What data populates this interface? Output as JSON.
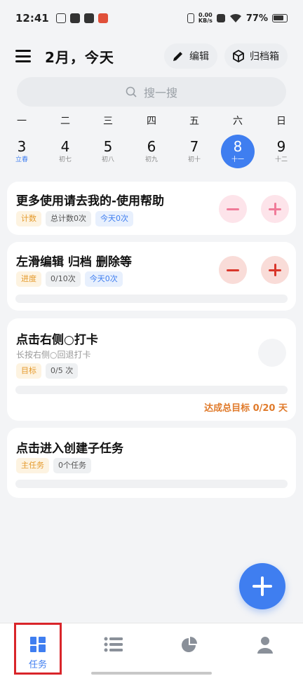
{
  "status_bar": {
    "time": "12:41",
    "net_speed_value": "0.00",
    "net_speed_unit": "KB/s",
    "battery": "77%"
  },
  "header": {
    "title": "2月，今天",
    "edit_label": "编辑",
    "archive_label": "归档箱"
  },
  "search": {
    "placeholder": "搜一搜"
  },
  "week": [
    {
      "name": "一",
      "num": "3",
      "sub": "立春",
      "selected": false
    },
    {
      "name": "二",
      "num": "4",
      "sub": "初七",
      "selected": false
    },
    {
      "name": "三",
      "num": "5",
      "sub": "初八",
      "selected": false
    },
    {
      "name": "四",
      "num": "6",
      "sub": "初九",
      "selected": false
    },
    {
      "name": "五",
      "num": "7",
      "sub": "初十",
      "selected": false
    },
    {
      "name": "六",
      "num": "8",
      "sub": "十一",
      "selected": true
    },
    {
      "name": "日",
      "num": "9",
      "sub": "十二",
      "selected": false
    }
  ],
  "tasks": [
    {
      "title": "更多使用请去我的-使用帮助",
      "tags": [
        "计数",
        "总计数0次",
        "今天0次"
      ]
    },
    {
      "title": "左滑编辑 归档 删除等",
      "tags": [
        "进度",
        "0/10次",
        "今天0次"
      ]
    },
    {
      "title": "点击右侧○打卡",
      "subtitle": "长按右侧○回退打卡",
      "tags": [
        "目标",
        "0/5 次"
      ],
      "goal": "达成总目标 0/20 天"
    },
    {
      "title": "点击进入创建子任务",
      "tags": [
        "主任务",
        "0个任务"
      ]
    }
  ],
  "bottom_nav": {
    "tasks_label": "任务"
  },
  "colors": {
    "accent": "#3f7ef0",
    "highlight": "#d9252a",
    "goal": "#e07b2c"
  }
}
